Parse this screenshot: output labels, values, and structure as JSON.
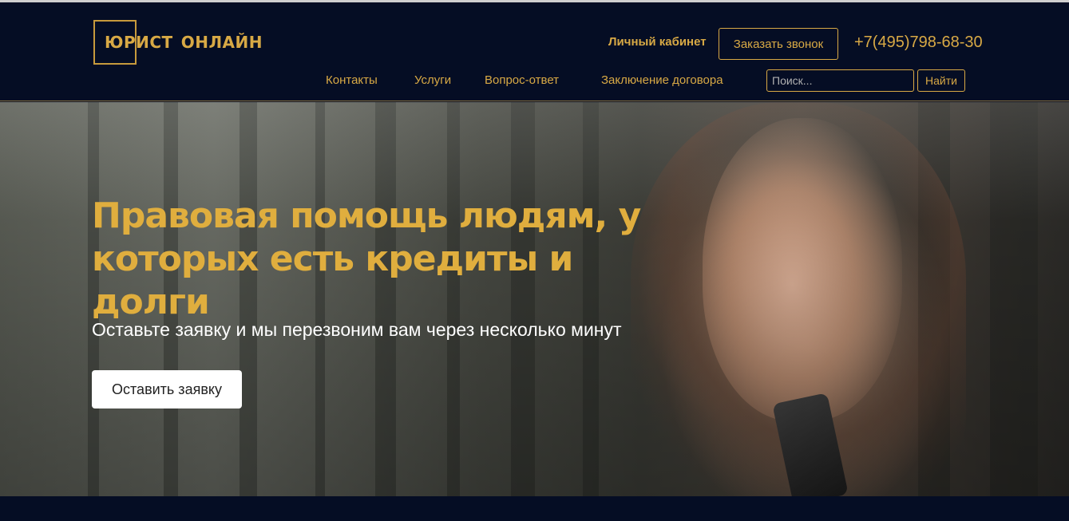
{
  "brand": {
    "word1": "ЮРИСТ",
    "word2": "ОНЛАЙН"
  },
  "header": {
    "cabinet_label": "Личный кабинет",
    "callback_label": "Заказать звонок",
    "phone": "+7(495)798-68-30"
  },
  "nav": {
    "items": [
      "Контакты",
      "Услуги",
      "Вопрос-ответ",
      "Заключение договора"
    ]
  },
  "search": {
    "placeholder": "Поиск...",
    "button_label": "Найти"
  },
  "hero": {
    "title": "Правовая помощь людям, у которых есть кредиты и долги",
    "subtitle": "Оставьте заявку и мы перезвоним вам через несколько минут",
    "cta_label": "Оставить заявку"
  },
  "colors": {
    "header_bg": "#050d24",
    "accent_gold": "#d8a945",
    "hero_title": "#e0ae3e",
    "button_bg": "#ffffff"
  }
}
